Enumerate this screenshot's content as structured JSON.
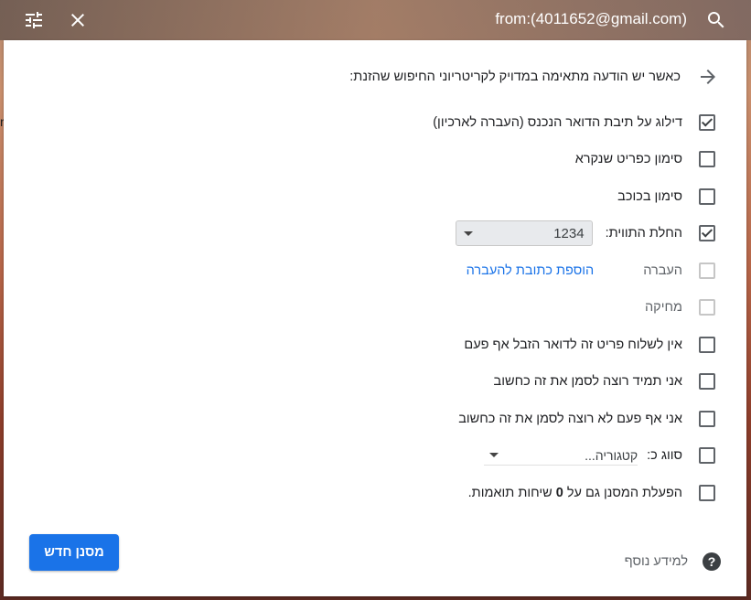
{
  "search": {
    "query": "from:(4011652@gmail.com)"
  },
  "background": {
    "left_strip_text": "r"
  },
  "filter": {
    "header": "כאשר יש הודעה מתאימה במדויק לקריטריוני החיפוש שהזנת:",
    "options": {
      "skip_inbox": {
        "label": "דילוג על תיבת הדואר הנכנס (העברה לארכיון)",
        "checked": true
      },
      "mark_read": {
        "label": "סימון כפריט שנקרא",
        "checked": false
      },
      "star": {
        "label": "סימון בכוכב",
        "checked": false
      },
      "apply_label": {
        "label": "החלת התווית:",
        "checked": true,
        "value": "1234"
      },
      "forward": {
        "label": "העברה",
        "link": "הוספת כתובת להעברה",
        "disabled": true
      },
      "delete": {
        "label": "מחיקה",
        "disabled": true
      },
      "never_spam": {
        "label": "אין לשלוח פריט זה לדואר הזבל אף פעם",
        "checked": false
      },
      "always_important": {
        "label": "אני תמיד רוצה לסמן את זה כחשוב",
        "checked": false
      },
      "never_important": {
        "label": "אני אף פעם לא רוצה לסמן את זה כחשוב",
        "checked": false
      },
      "categorize": {
        "label": "סווג כ:",
        "value": "קטגוריה...",
        "checked": false
      },
      "also_apply": {
        "prefix": "הפעלת המסנן גם על",
        "count": "0",
        "suffix": "שיחות תואמות.",
        "checked": false
      }
    },
    "footer": {
      "learn_more": "למידע נוסף",
      "help_symbol": "?",
      "create_button": "מסנן חדש"
    }
  }
}
